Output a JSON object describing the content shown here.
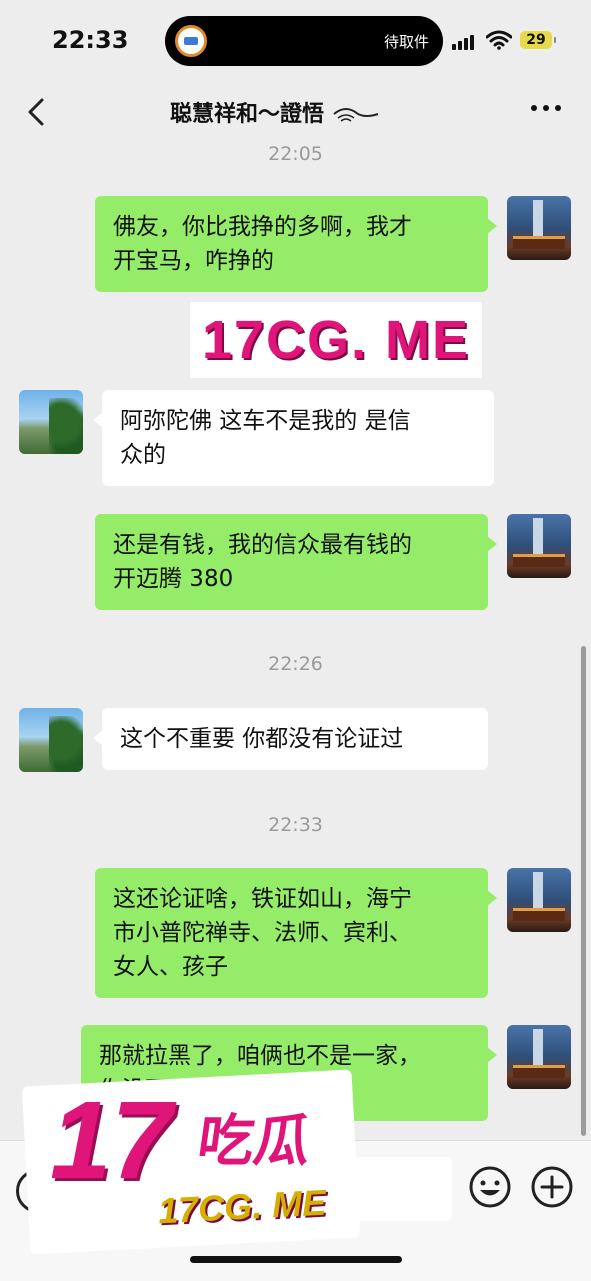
{
  "status_bar": {
    "time": "22:33",
    "island_text": "待取件",
    "battery": "29"
  },
  "header": {
    "title": "聪慧祥和～證悟",
    "title_decoration_icon": "eye-icon",
    "back_icon": "chevron-left-icon",
    "more_icon": "more-dots-icon"
  },
  "messages": [
    {
      "type": "timestamp",
      "text": "22:05"
    },
    {
      "type": "msg",
      "side": "right",
      "text": "佛友，你比我挣的多啊，我才开宝马，咋挣的",
      "lines": [
        "佛友，你比我挣的多啊，我才",
        "开宝马，咋挣的"
      ]
    },
    {
      "type": "msg",
      "side": "left",
      "text": "阿弥陀佛  这车不是我的  是信众的",
      "lines": [
        "阿弥陀佛  这车不是我的  是信",
        "众的"
      ]
    },
    {
      "type": "msg",
      "side": "right",
      "text": "还是有钱，我的信众最有钱的开迈腾 380",
      "lines": [
        "还是有钱，我的信众最有钱的",
        "开迈腾 380"
      ]
    },
    {
      "type": "timestamp",
      "text": "22:26"
    },
    {
      "type": "msg",
      "side": "left",
      "text": "这个不重要  你都没有论证过",
      "lines": [
        "这个不重要  你都没有论证过"
      ]
    },
    {
      "type": "timestamp",
      "text": "22:33"
    },
    {
      "type": "msg",
      "side": "right",
      "text": "这还论证啥，铁证如山，海宁市小普陀禅寺、法师、宾利、女人、孩子",
      "lines": [
        "这还论证啥，铁证如山，海宁",
        "市小普陀禅寺、法师、宾利、",
        "女人、孩子"
      ]
    },
    {
      "type": "msg",
      "side": "right",
      "text": "那就拉黑了，咱俩也不是一家，你没面子",
      "lines": [
        "那就拉黑了，咱俩也不是一家，",
        "你没面子"
      ]
    }
  ],
  "watermark": {
    "banner": "17CG. ME",
    "logo_number": "17",
    "logo_cn": "吃瓜",
    "logo_domain": "17CG. ME"
  },
  "input_bar": {
    "voice_icon": "voice-icon",
    "emoji_icon": "emoji-icon",
    "plus_icon": "plus-icon"
  },
  "colors": {
    "background": "#ededed",
    "my_bubble": "#95ec69",
    "other_bubble": "#ffffff",
    "watermark_pink": "#e0157a"
  }
}
